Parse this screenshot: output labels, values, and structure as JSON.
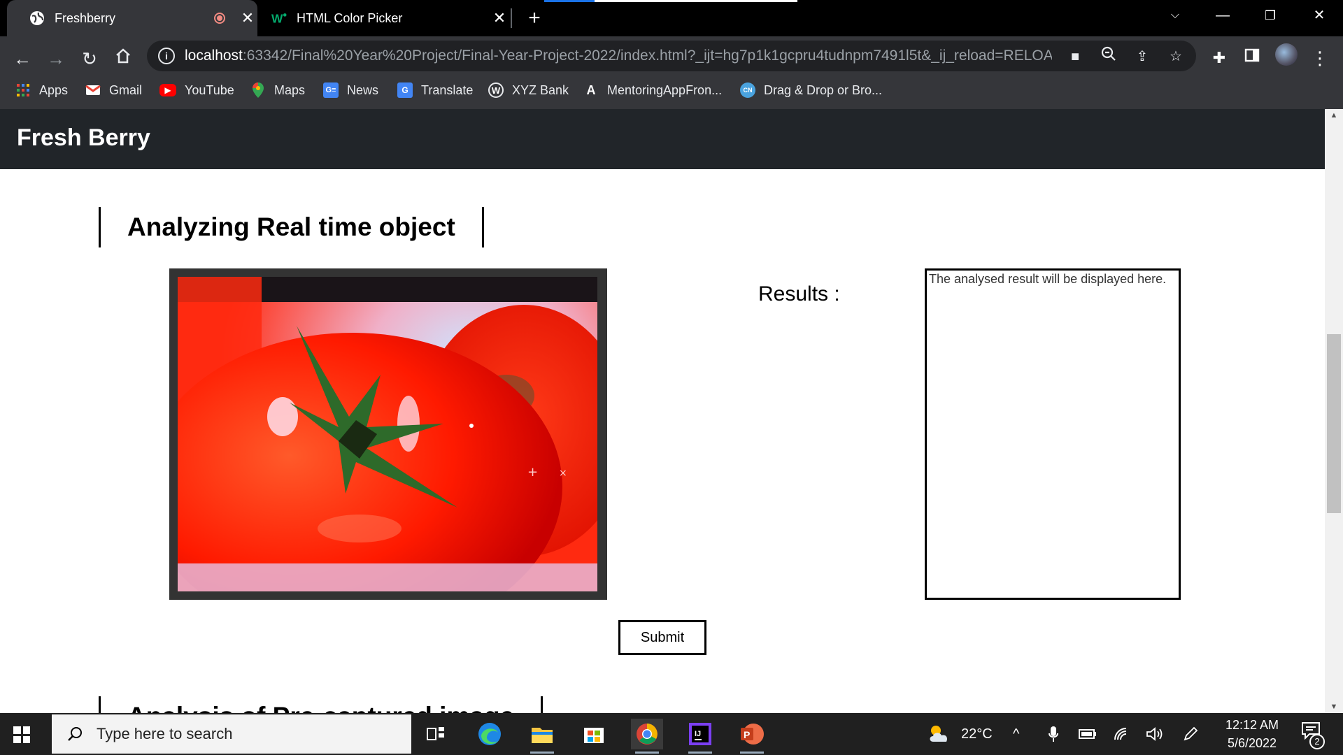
{
  "browser": {
    "tabs": [
      {
        "title": "Freshberry",
        "active": true,
        "recording": true
      },
      {
        "title": "HTML Color Picker",
        "active": false
      }
    ],
    "url_host": "localhost",
    "url_rest": ":63342/Final%20Year%20Project/Final-Year-Project-2022/index.html?_ijt=hg7p1k1gcpru4tudnpm7491l5t&_ij_reload=RELOA...",
    "bookmarks": [
      {
        "label": "Apps",
        "icon": "apps-grid-icon"
      },
      {
        "label": "Gmail",
        "icon": "gmail-icon"
      },
      {
        "label": "YouTube",
        "icon": "youtube-icon"
      },
      {
        "label": "Maps",
        "icon": "maps-icon"
      },
      {
        "label": "News",
        "icon": "news-icon"
      },
      {
        "label": "Translate",
        "icon": "translate-icon"
      },
      {
        "label": "XYZ Bank",
        "icon": "wordpress-icon"
      },
      {
        "label": "MentoringAppFron...",
        "icon": "angular-icon"
      },
      {
        "label": "Drag & Drop or Bro...",
        "icon": "cn-icon"
      }
    ]
  },
  "page": {
    "site_title": "Fresh Berry",
    "section1_heading": "Analyzing Real time object",
    "results_label": "Results :",
    "results_placeholder": "The analysed result will be displayed here.",
    "submit_label": "Submit",
    "section2_heading": "Analysis of Pre-captured image"
  },
  "taskbar": {
    "search_placeholder": "Type here to search",
    "weather": "22°C",
    "time": "12:12 AM",
    "date": "5/6/2022",
    "notification_count": "2"
  },
  "colors": {
    "chrome_dark": "#35363a",
    "header_bg": "#212529",
    "taskbar_bg": "#202020"
  }
}
